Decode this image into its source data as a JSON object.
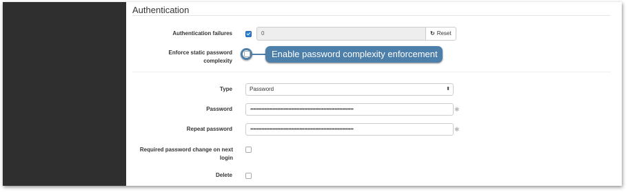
{
  "section": {
    "title": "Authentication"
  },
  "auth_failures": {
    "label": "Authentication failures",
    "checked": true,
    "value": "0",
    "reset_label": "Reset",
    "reset_icon": "refresh-icon"
  },
  "enforce_static": {
    "label": "Enforce static password complexity",
    "label_line1": "Enforce static password",
    "label_line2": "complexity",
    "checked": false
  },
  "callout": {
    "text": "Enable password complexity enforcement",
    "color": "#4d7fab"
  },
  "type": {
    "label": "Type",
    "selected": "Password"
  },
  "password": {
    "label": "Password",
    "value": "•••••••••••••••••••••••••••••••••••••••••••••••••••••••••••••••••",
    "generate_icon": "gear-icon"
  },
  "repeat_password": {
    "label": "Repeat password",
    "value": "•••••••••••••••••••••••••••••••••••••••••••••••••••••••••••••••••",
    "generate_icon": "gear-icon"
  },
  "required_change": {
    "label_line1": "Required password change on next",
    "label_line2": "login",
    "checked": false
  },
  "delete": {
    "label": "Delete",
    "checked": false
  },
  "colors": {
    "sidebar": "#2f2f2f",
    "accent": "#2d7fd1"
  }
}
